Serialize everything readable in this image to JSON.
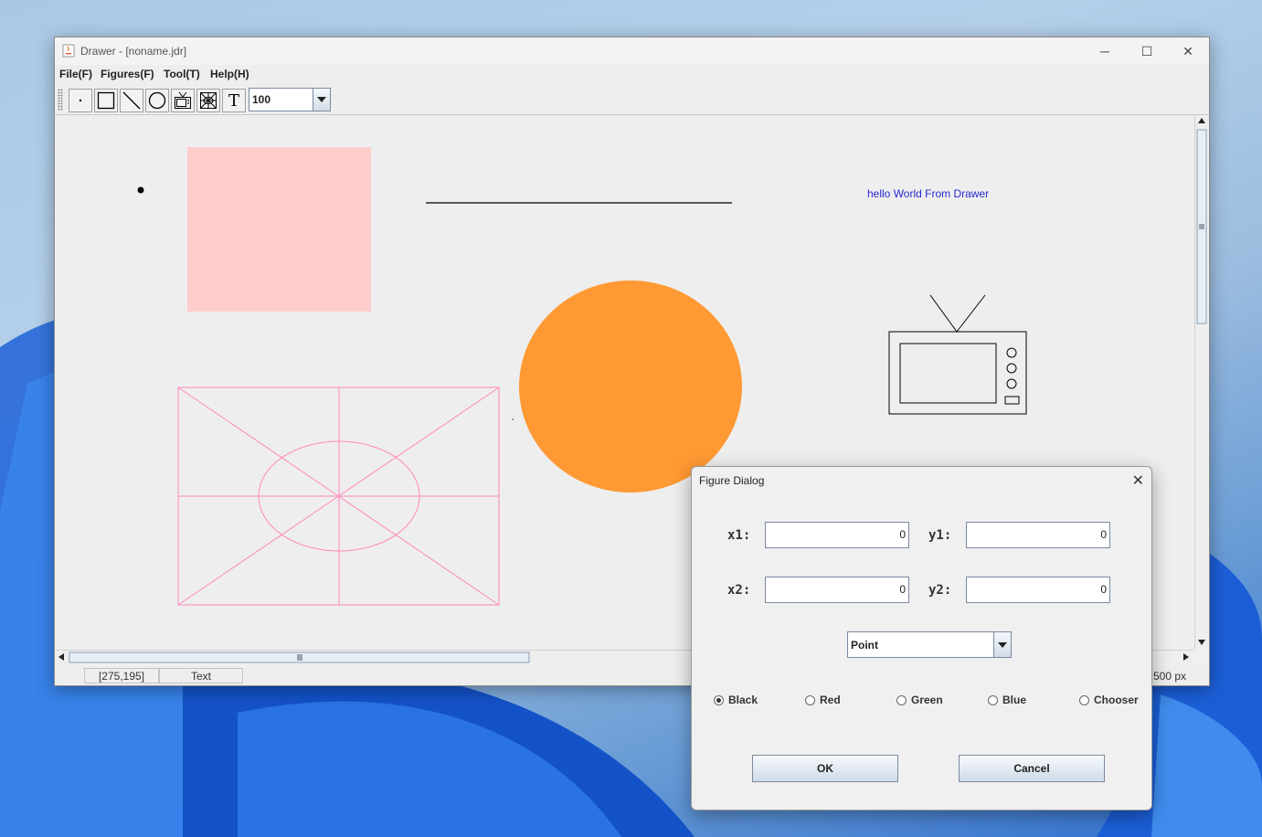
{
  "window": {
    "title": "Drawer - [noname.jdr]",
    "minimize_glyph": "─",
    "maximize_glyph": "☐",
    "close_glyph": "✕"
  },
  "menubar": {
    "items": [
      {
        "label": "File(F)"
      },
      {
        "label": "Figures(F)"
      },
      {
        "label": "Tool(T)"
      },
      {
        "label": "Help(H)"
      }
    ]
  },
  "toolbar": {
    "tools": [
      {
        "icon": "point-tool-icon"
      },
      {
        "icon": "box-tool-icon"
      },
      {
        "icon": "line-tool-icon"
      },
      {
        "icon": "oval-tool-icon"
      },
      {
        "icon": "tv-tool-icon"
      },
      {
        "icon": "kite-tool-icon"
      },
      {
        "icon": "text-tool-icon",
        "glyph": "T"
      }
    ],
    "zoom_value": "100"
  },
  "canvas": {
    "text_figure": "hello World From Drawer",
    "colors": {
      "box": "#ffcccc",
      "circle": "#ff9933",
      "kite": "#ff88bb",
      "text": "#2a2ad0",
      "line": "#000000"
    }
  },
  "statusbar": {
    "coords": "[275,195]",
    "mode": "Text",
    "size_text": "500 px"
  },
  "dialog": {
    "title": "Figure Dialog",
    "close_glyph": "✕",
    "x1_label": "x1:",
    "y1_label": "y1:",
    "x2_label": "x2:",
    "y2_label": "y2:",
    "x1_value": "0",
    "y1_value": "0",
    "x2_value": "0",
    "y2_value": "0",
    "figure_type": "Point",
    "colors": [
      {
        "label": "Black",
        "selected": true
      },
      {
        "label": "Red",
        "selected": false
      },
      {
        "label": "Green",
        "selected": false
      },
      {
        "label": "Blue",
        "selected": false
      },
      {
        "label": "Chooser",
        "selected": false
      }
    ],
    "ok_label": "OK",
    "cancel_label": "Cancel"
  }
}
